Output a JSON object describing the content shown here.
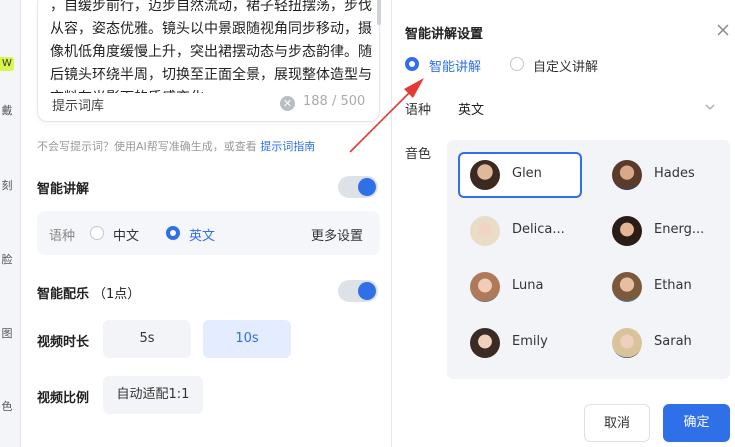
{
  "left_strip": {
    "badge": "W",
    "items": [
      "戴",
      "刻",
      "脸",
      "图",
      "色"
    ]
  },
  "prompt": {
    "text": "，自缓步前行，迈步自然流动，裙子轻扭摆荡，步伐从容，姿态优雅。镜头以中景跟随视角同步移动，摄像机低角度缓慢上升，突出裙摆动态与步态韵律。随后镜头环绕半周，切换至正面全景，展现整体造型与衣料在光影下的质感变化",
    "library_label": "提示词库",
    "counter": "188 / 500"
  },
  "hint": {
    "text": "不会写提示词？使用AI帮写准确生成，或查看 ",
    "link": "提示词指南"
  },
  "smart_narration": {
    "title": "智能讲解",
    "lang_label": "语种",
    "options": [
      "中文",
      "英文"
    ],
    "more": "更多设置"
  },
  "smart_music": {
    "title": "智能配乐",
    "points": "（1点）"
  },
  "duration": {
    "label": "视频时长",
    "options": [
      "5s",
      "10s"
    ]
  },
  "ratio": {
    "label": "视频比例",
    "value": "自动适配1:1"
  },
  "modal": {
    "title": "智能讲解设置",
    "mode_options": [
      "智能讲解",
      "自定义讲解"
    ],
    "lang_label": "语种",
    "lang_value": "英文",
    "voice_label": "音色",
    "voices": [
      "Glen",
      "Hades",
      "Delica...",
      "Energ...",
      "Luna",
      "Ethan",
      "Emily",
      "Sarah"
    ],
    "cancel": "取消",
    "confirm": "确定"
  },
  "colors": {
    "accent": "#2f6fe8",
    "arrow": "#e53935"
  }
}
